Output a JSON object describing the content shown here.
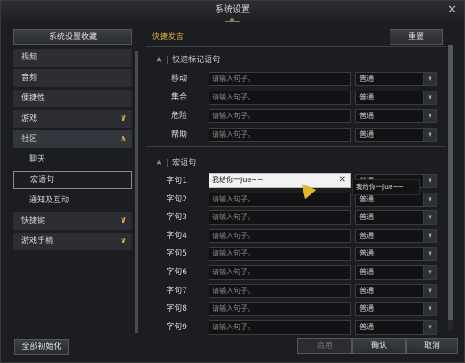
{
  "window": {
    "title": "系统设置"
  },
  "sidebar": {
    "favorites_label": "系统设置收藏",
    "items": [
      {
        "label": "视频",
        "chevron": ""
      },
      {
        "label": "音频",
        "chevron": ""
      },
      {
        "label": "便捷性",
        "chevron": ""
      },
      {
        "label": "游戏",
        "chevron": "∨"
      },
      {
        "label": "社区",
        "chevron": "∧"
      }
    ],
    "sub_items": [
      "聊天",
      "宏语句",
      "通知及互动"
    ],
    "items_after": [
      {
        "label": "快捷键",
        "chevron": "∨"
      },
      {
        "label": "游戏手柄",
        "chevron": "∨"
      }
    ],
    "reset_all_label": "全部初始化"
  },
  "content": {
    "section_title": "快捷发言",
    "reset_label": "重置",
    "group1": {
      "title": "快速标记语句",
      "rows": [
        {
          "label": "移动",
          "placeholder": "请输入句子。",
          "channel": "普通"
        },
        {
          "label": "集合",
          "placeholder": "请输入句子。",
          "channel": "普通"
        },
        {
          "label": "危险",
          "placeholder": "请输入句子。",
          "channel": "普通"
        },
        {
          "label": "帮助",
          "placeholder": "请输入句子。",
          "channel": "普通"
        }
      ]
    },
    "group2": {
      "title": "宏语句",
      "active_value": "我给你一jue~~",
      "dropdown_overlay": "我给你一jue~~",
      "rows": [
        {
          "label": "字句1",
          "placeholder": "请输入句子。",
          "channel": "普通"
        },
        {
          "label": "字句2",
          "placeholder": "请输入句子。",
          "channel": "普通"
        },
        {
          "label": "字句3",
          "placeholder": "请输入句子。",
          "channel": "普通"
        },
        {
          "label": "字句4",
          "placeholder": "请输入句子。",
          "channel": "普通"
        },
        {
          "label": "字句5",
          "placeholder": "请输入句子。",
          "channel": "普通"
        },
        {
          "label": "字句6",
          "placeholder": "请输入句子。",
          "channel": "普通"
        },
        {
          "label": "字句7",
          "placeholder": "请输入句子。",
          "channel": "普通"
        },
        {
          "label": "字句8",
          "placeholder": "请输入句子。",
          "channel": "普通"
        },
        {
          "label": "字句9",
          "placeholder": "请输入句子。",
          "channel": "普通"
        }
      ]
    }
  },
  "footer": {
    "apply_label": "启用",
    "ok_label": "确认",
    "cancel_label": "取消"
  },
  "icons": {
    "close": "✕",
    "star": "★",
    "dropdown_arrow": "∨",
    "clear": "✕"
  },
  "colors": {
    "accent": "#d6b24a",
    "chevron": "#e0b032",
    "cursor": "#e5b52b"
  }
}
